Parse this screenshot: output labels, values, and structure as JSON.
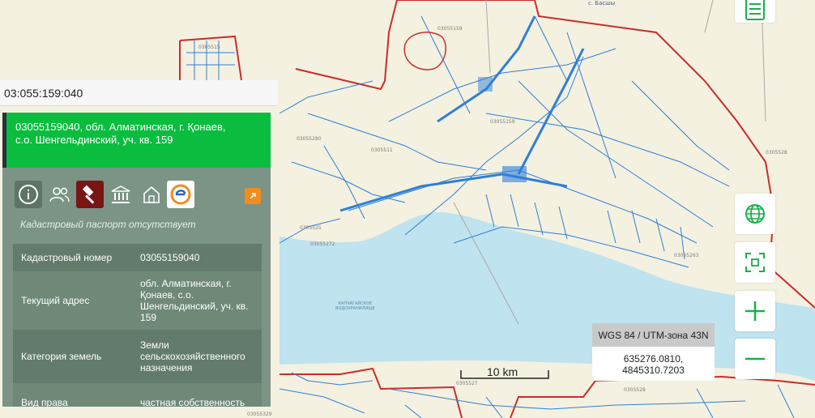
{
  "search": {
    "value": "03:055:159:040"
  },
  "parcel": {
    "title": "03055159040, обл. Алматинская, г. Қонаев, с.о. Шенгельдинский, уч. кв. 159",
    "passport_note": "Кадастровый паспорт отсутствует",
    "rows": [
      {
        "label": "Кадастровый номер",
        "value": "03055159040"
      },
      {
        "label": "Текущий адрес",
        "value": "обл. Алматинская, г. Қонаев, с.о. Шенгельдинский, уч. кв. 159"
      },
      {
        "label": "Категория земель",
        "value": "Земли сельскохозяйственного назначения"
      },
      {
        "label": "Вид права",
        "value": "частная собственность"
      }
    ]
  },
  "toolbar": {
    "icons": [
      "info-icon",
      "people-icon",
      "gavel-icon",
      "bank-icon",
      "home-icon",
      "e-service-icon",
      "external-link-icon"
    ],
    "accent_color": "#0bbd3e"
  },
  "coordinates": {
    "system": "WGS 84 / UTM-зона 43N",
    "x": "635276.0810,",
    "y": "4845310.7203"
  },
  "scale": {
    "label": "10 km"
  },
  "map": {
    "town": "с. Басшы",
    "parcel_labels": [
      "03055159",
      "0305515",
      "03055159",
      "0305511",
      "03055280",
      "0305528",
      "03055263",
      "03055272",
      "0305525",
      "03055329",
      "0305527",
      "0305528"
    ],
    "water_label": [
      "КАПЧАГАЙСКОЕ",
      "ВОДОХРАНИЛИЩЕ"
    ]
  },
  "controls": [
    "list-icon",
    "globe-icon",
    "fullscreen-icon",
    "zoom-in-icon",
    "zoom-out-icon"
  ]
}
